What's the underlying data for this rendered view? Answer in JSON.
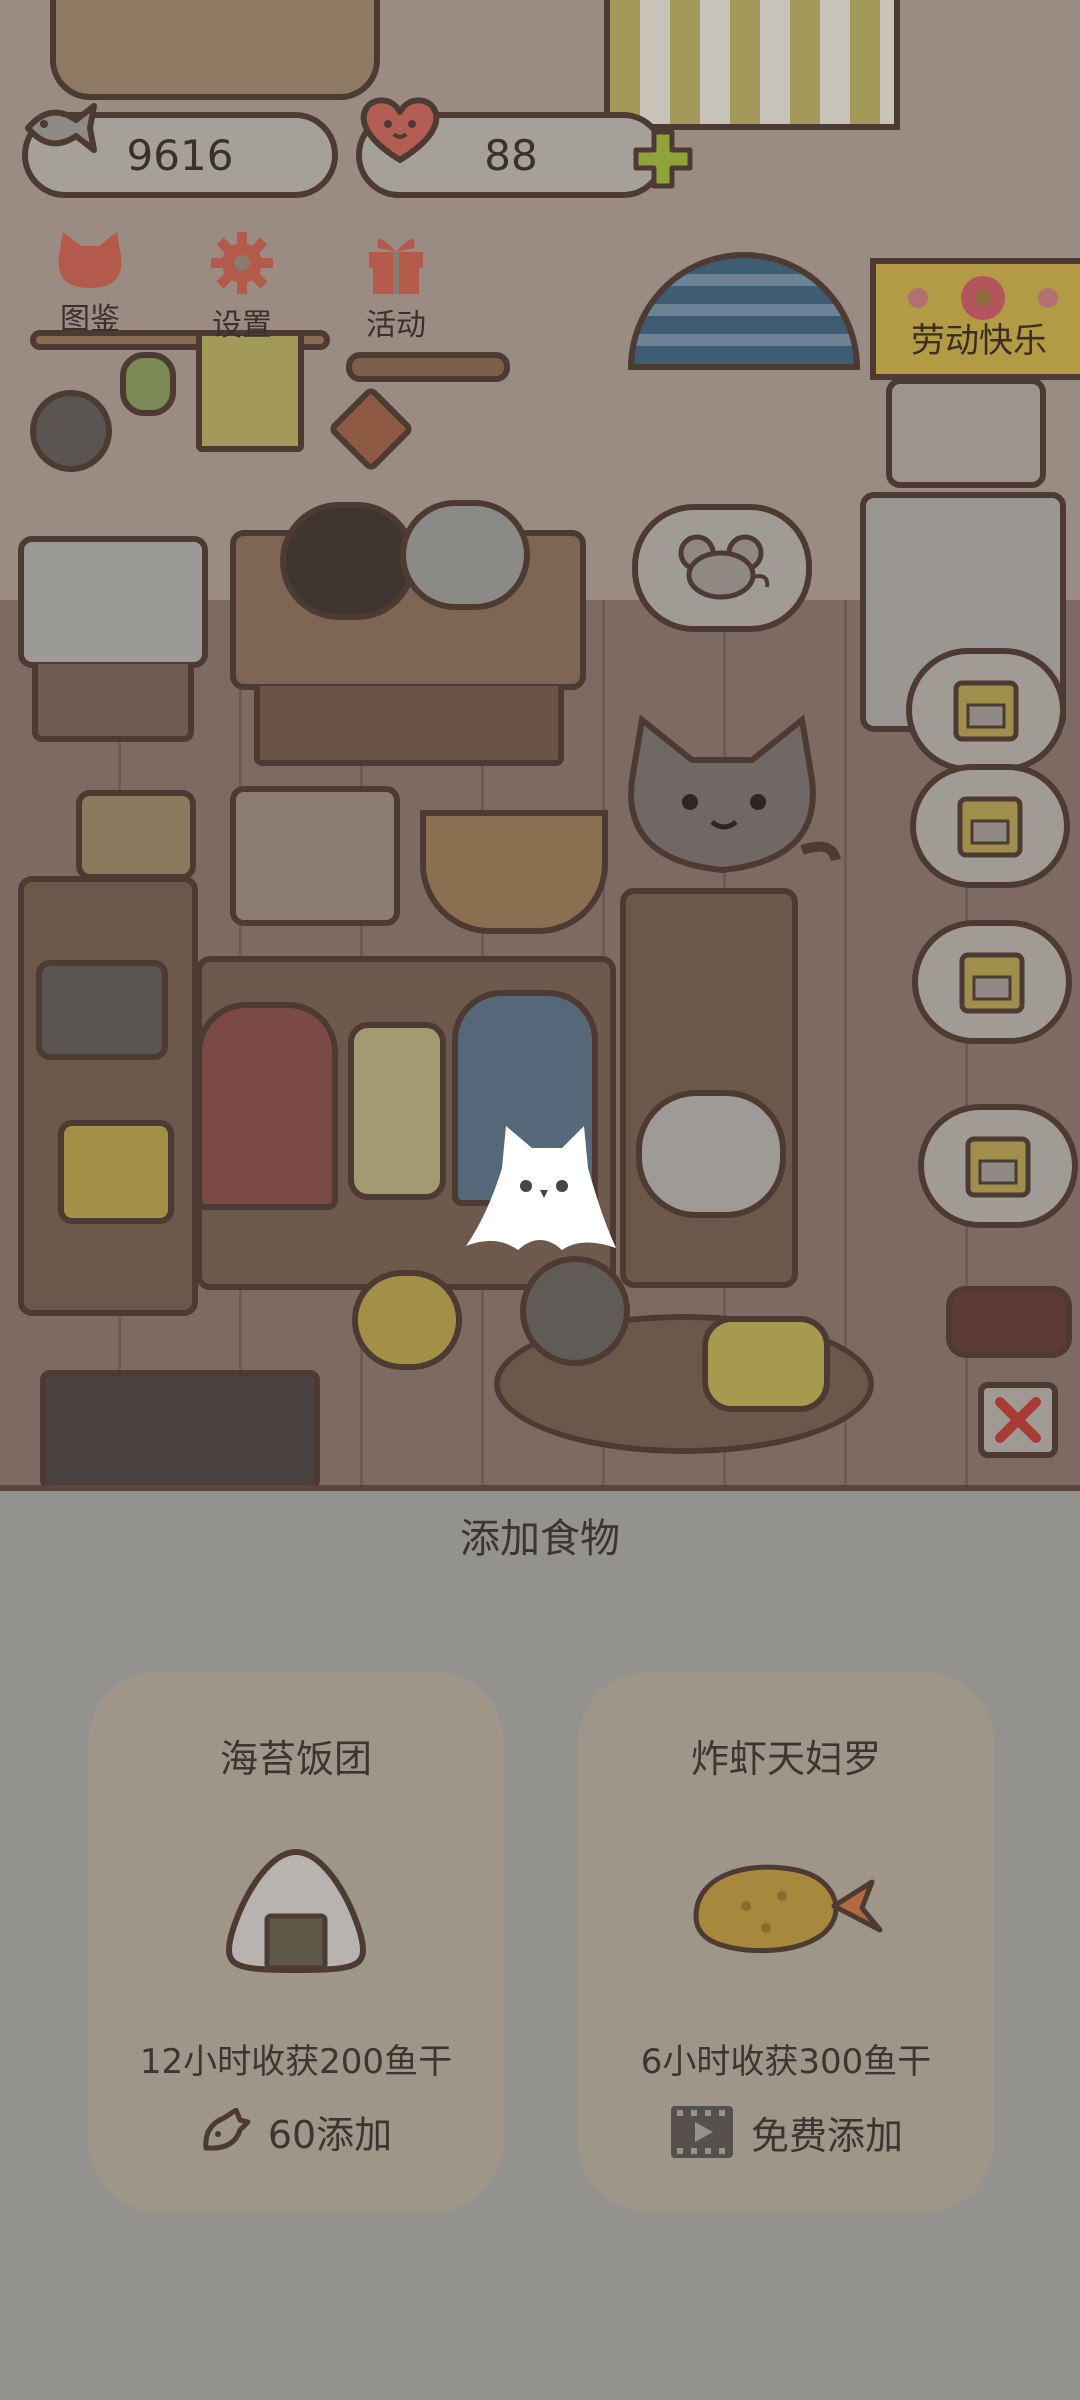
{
  "hud": {
    "fish_count": "9616",
    "heart_count": "88",
    "fish_icon": "fish-icon",
    "heart_icon": "heart-icon",
    "plus_icon": "plus-icon"
  },
  "nav": {
    "catalog_label": "图鉴",
    "settings_label": "设置",
    "events_label": "活动"
  },
  "banner": {
    "label": "劳动快乐"
  },
  "sheet": {
    "title": "添加食物",
    "foods": [
      {
        "name": "海苔饭团",
        "icon": "rice-ball-icon",
        "desc": "12小时收获200鱼干",
        "action_icon": "fish-icon",
        "action": "60添加"
      },
      {
        "name": "炸虾天妇罗",
        "icon": "shrimp-tempura-icon",
        "desc": "6小时收获300鱼干",
        "action_icon": "video-icon",
        "action": "免费添加"
      }
    ]
  },
  "colors": {
    "outline": "#4d3a33",
    "text": "#3e3431",
    "plus_green": "#8fa33a",
    "overlay_bg": "#94928e"
  }
}
